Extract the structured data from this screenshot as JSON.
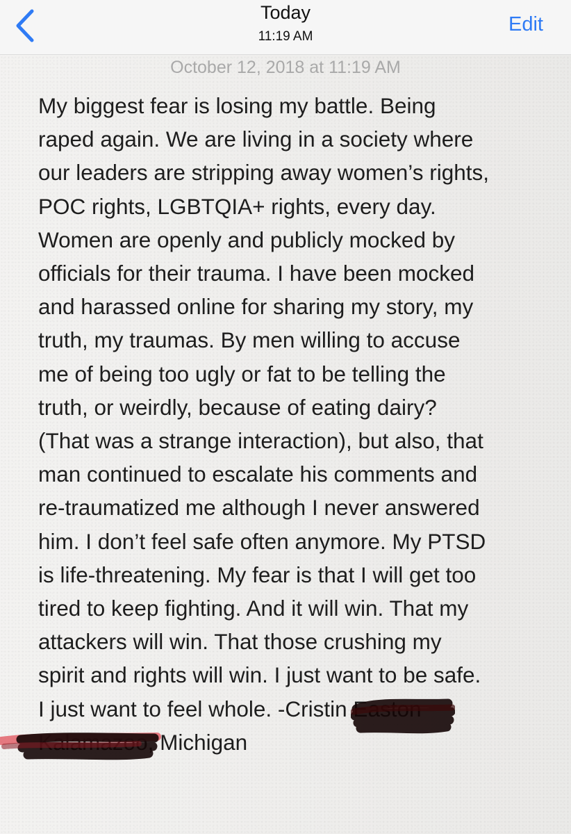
{
  "nav": {
    "back_icon": "chevron-left-icon",
    "title": "Today",
    "subtitle": "11:19 AM",
    "edit_label": "Edit",
    "accent_color": "#2f7bf5"
  },
  "note": {
    "date": "October 12, 2018 at 11:19 AM",
    "body": "My biggest fear is losing my battle. Being\nraped again. We are living in a society where\nour leaders are stripping away women’s rights,\nPOC rights, LGBTQIA+ rights, every day.\nWomen are openly and publicly mocked by\nofficials for their trauma. I have been mocked\nand harassed online for sharing my story, my\ntruth, my traumas. By men willing to accuse\nme of being too ugly or fat to be telling the\ntruth, or weirdly, because of eating dairy?\n(That was a strange interaction), but also, that\nman continued to escalate his comments and\nre-traumatized me although I never answered\nhim. I don’t feel safe often anymore. My PTSD\nis life-threatening. My fear is that I will get too\ntired to keep fighting. And it will win. That my\nattackers will win. That those crushing my\nspirit and rights will win. I just want to be safe.\nI just want to feel whole. -Cristin Easton\nKalamazoo, Michigan"
  }
}
